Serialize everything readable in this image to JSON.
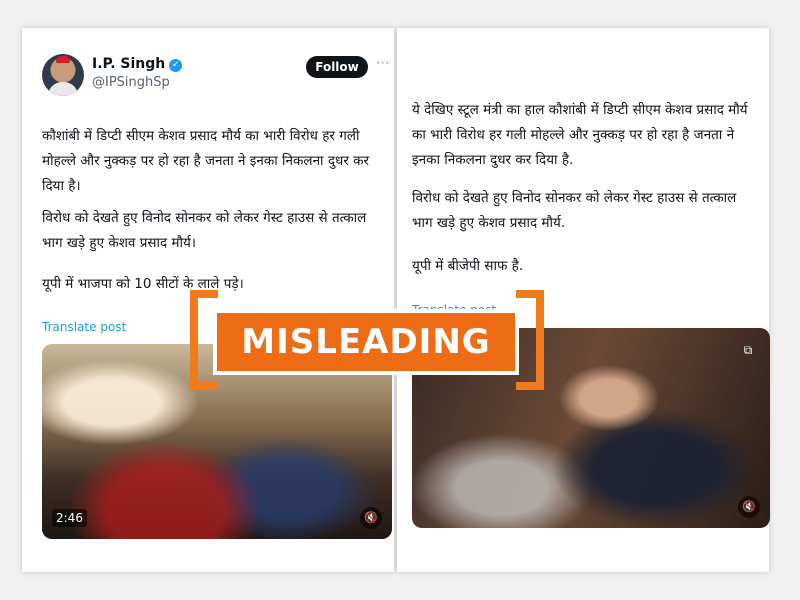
{
  "left_post": {
    "author": {
      "name": "I.P. Singh",
      "verified_mark": "✓",
      "handle": "@IPSinghSp",
      "follow_label": "Follow",
      "more_icon": "⋯"
    },
    "paragraphs": [
      "कौशांबी में डिप्टी सीएम केशव प्रसाद मौर्य का भारी विरोध हर गली मोहल्ले और नुक्कड़ पर हो रहा है जनता ने इनका निकलना दुधर कर दिया है।",
      "विरोध को देखते हुए विनोद सोनकर को लेकर गेस्ट हाउस से तत्काल भाग खड़े हुए केशव प्रसाद मौर्य।",
      "यूपी में भाजपा को 10 सीटों के लाले पड़े।"
    ],
    "translate_label": "Translate post",
    "video": {
      "duration": "2:46",
      "mute_icon": "🔇"
    }
  },
  "right_post": {
    "paragraphs": [
      "ये देखिए स्टूल मंत्री का हाल कौशांबी में डिप्टी सीएम केशव प्रसाद मौर्य का भारी विरोध हर गली मोहल्ले और नुक्कड़ पर हो रहा है जनता ने इनका निकलना दुधर कर दिया है.",
      "विरोध को देखते हुए विनोद सोनकर को लेकर गेस्ट हाउस से तत्काल भाग खड़े हुए केशव प्रसाद मौर्य.",
      "यूपी में बीजेपी साफ है."
    ],
    "translate_label": "Translate post",
    "video": {
      "pip_icon": "⧉",
      "mute_icon": "🔇"
    }
  },
  "stamp": {
    "label": "MISLEADING",
    "color": "#ef6c16",
    "bracket_color": "#ef7b1a"
  }
}
